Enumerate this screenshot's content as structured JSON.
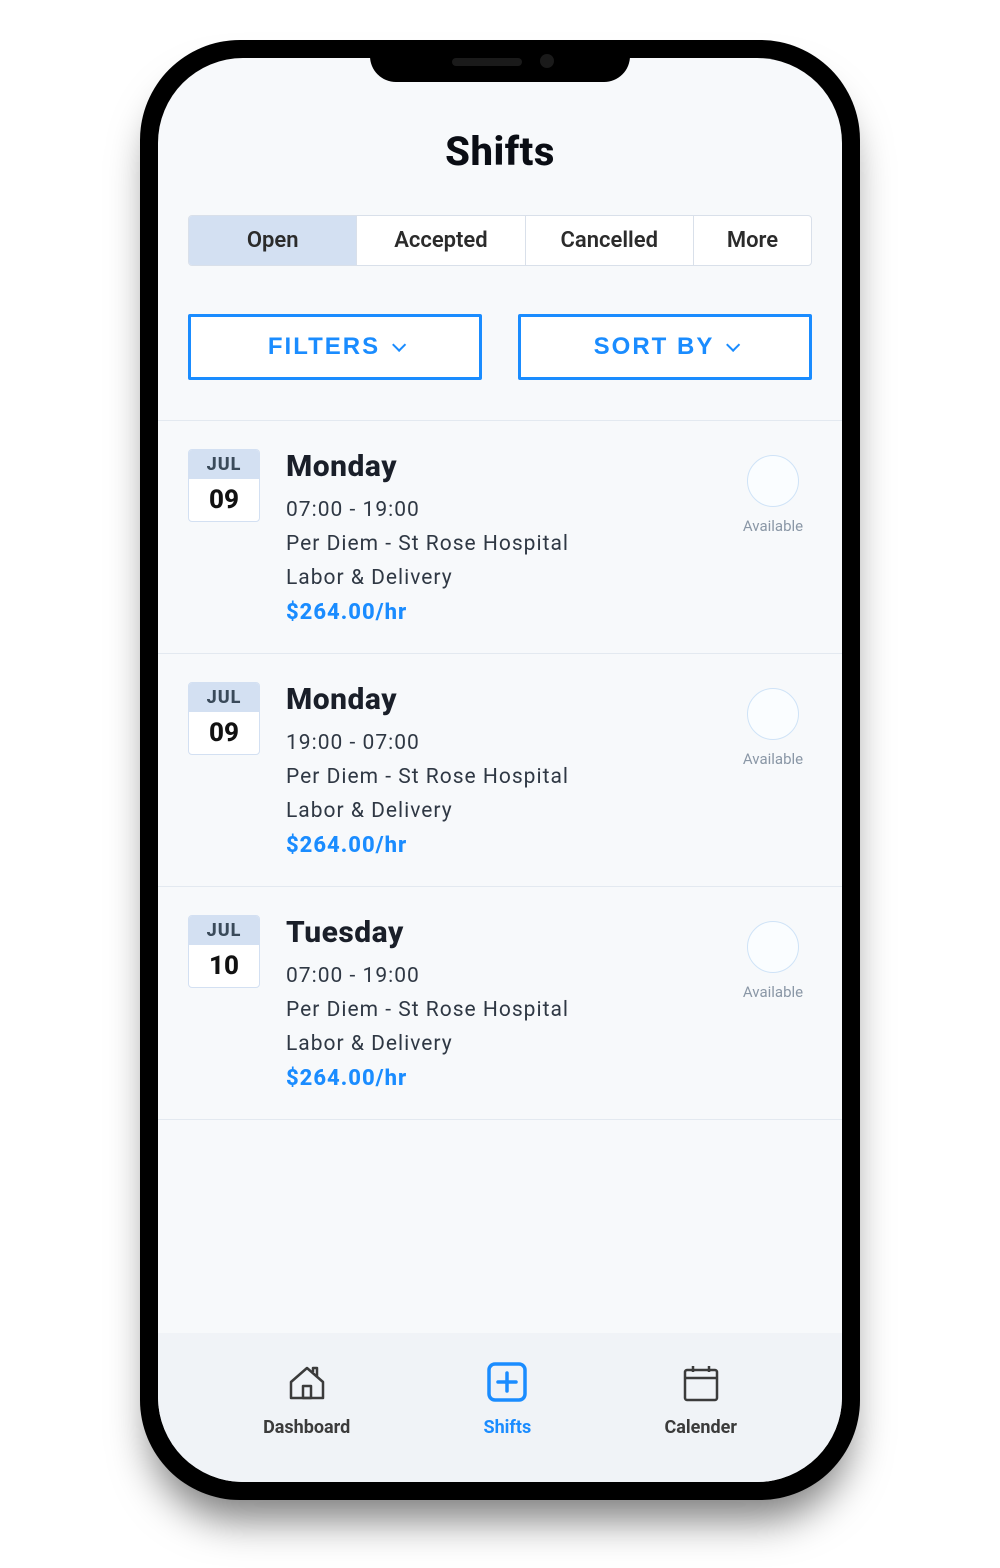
{
  "header": {
    "title": "Shifts"
  },
  "tabs": [
    {
      "label": "Open",
      "active": true
    },
    {
      "label": "Accepted",
      "active": false
    },
    {
      "label": "Cancelled",
      "active": false
    },
    {
      "label": "More",
      "active": false
    }
  ],
  "controls": {
    "filters_label": "FILTERS",
    "sort_label": "SORT BY"
  },
  "shifts": [
    {
      "month": "JUL",
      "day": "09",
      "dow": "Monday",
      "time": "07:00 - 19:00",
      "facility": "Per Diem - St Rose Hospital",
      "unit": "Labor & Delivery",
      "rate": "$264.00/hr",
      "status": "Available"
    },
    {
      "month": "JUL",
      "day": "09",
      "dow": "Monday",
      "time": "19:00 - 07:00",
      "facility": "Per Diem - St Rose Hospital",
      "unit": "Labor & Delivery",
      "rate": "$264.00/hr",
      "status": "Available"
    },
    {
      "month": "JUL",
      "day": "10",
      "dow": "Tuesday",
      "time": "07:00 - 19:00",
      "facility": "Per Diem - St Rose Hospital",
      "unit": "Labor & Delivery",
      "rate": "$264.00/hr",
      "status": "Available"
    }
  ],
  "nav": [
    {
      "label": "Dashboard",
      "icon": "home",
      "active": false
    },
    {
      "label": "Shifts",
      "icon": "plus",
      "active": true
    },
    {
      "label": "Calender",
      "icon": "calendar",
      "active": false
    }
  ],
  "colors": {
    "accent": "#1a8cff"
  }
}
